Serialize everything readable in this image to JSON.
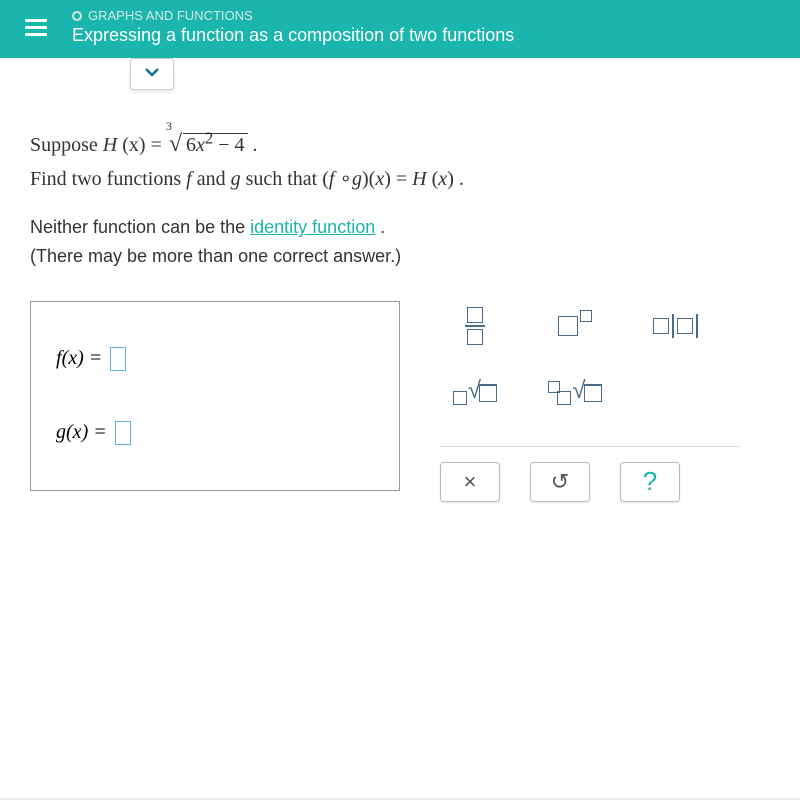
{
  "header": {
    "category": "GRAPHS AND FUNCTIONS",
    "title": "Expressing a function as a composition of two functions"
  },
  "problem": {
    "suppose_prefix": "Suppose ",
    "h_func": "H",
    "h_arg": "(x) = ",
    "root_index": "3",
    "radicand": "6x² − 4",
    "suppose_suffix": ".",
    "line2_a": "Find two functions ",
    "f": "f",
    "line2_b": " and ",
    "g": "g",
    "line2_c": " such that ",
    "comp": "(f ∘g)(x) = H (x)",
    "line2_d": ".",
    "line3_a": "Neither function can be the ",
    "identity_link": "identity function",
    "line3_b": ".",
    "line4": "(There may be more than one correct answer.)"
  },
  "answers": {
    "f_label": "f(x) = ",
    "g_label": "g(x) = "
  },
  "toolbox": {
    "clear": "×",
    "undo": "↺",
    "help": "?"
  }
}
